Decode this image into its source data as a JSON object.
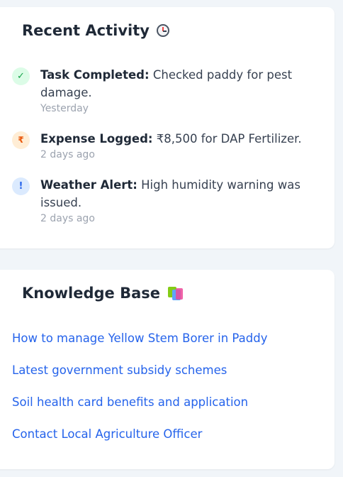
{
  "recent_activity": {
    "title": "Recent Activity",
    "title_icon": "clock-icon",
    "items": [
      {
        "icon": "check-icon",
        "icon_glyph": "✓",
        "heading": "Task Completed:",
        "text": " Checked paddy for pest damage.",
        "time": "Yesterday"
      },
      {
        "icon": "rupee-icon",
        "icon_glyph": "₹",
        "heading": "Expense Logged:",
        "text": " ₹8,500 for DAP Fertilizer.",
        "time": "2 days ago"
      },
      {
        "icon": "alert-icon",
        "icon_glyph": "!",
        "heading": "Weather Alert:",
        "text": " High humidity warning was issued.",
        "time": "2 days ago"
      }
    ]
  },
  "knowledge_base": {
    "title": "Knowledge Base",
    "title_icon": "books-icon",
    "links": [
      "How to manage Yellow Stem Borer in Paddy",
      "Latest government subsidy schemes",
      "Soil health card benefits and application",
      "Contact Local Agriculture Officer"
    ]
  },
  "colors": {
    "link": "#2563eb",
    "check": "#16a34a",
    "expense": "#ea580c",
    "alert": "#2563eb",
    "muted": "#9ca3af"
  }
}
